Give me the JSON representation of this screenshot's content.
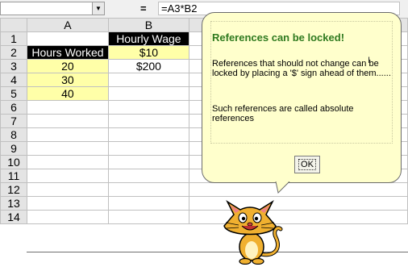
{
  "formula_bar": {
    "name_box": "",
    "equals": "=",
    "formula": "=A3*B2"
  },
  "grid": {
    "columns": [
      "A",
      "B"
    ],
    "rows": [
      {
        "num": "1",
        "a": "",
        "b": "Hourly Wage"
      },
      {
        "num": "2",
        "a": "Hours Worked",
        "b": "$10"
      },
      {
        "num": "3",
        "a": "20",
        "b": "$200"
      },
      {
        "num": "4",
        "a": "30",
        "b": ""
      },
      {
        "num": "5",
        "a": "40",
        "b": ""
      },
      {
        "num": "6",
        "a": "",
        "b": ""
      },
      {
        "num": "7",
        "a": "",
        "b": ""
      },
      {
        "num": "8",
        "a": "",
        "b": ""
      },
      {
        "num": "9",
        "a": "",
        "b": ""
      },
      {
        "num": "10",
        "a": "",
        "b": ""
      },
      {
        "num": "11",
        "a": "",
        "b": ""
      },
      {
        "num": "12",
        "a": "",
        "b": ""
      },
      {
        "num": "13",
        "a": "",
        "b": ""
      },
      {
        "num": "14",
        "a": "",
        "b": ""
      }
    ]
  },
  "balloon": {
    "title": "References can be locked!",
    "paragraph1": "References that should not change can be locked by placing a '$' sign ahead of them......",
    "paragraph2": "Such references are called absolute references",
    "ok_label": "OK"
  },
  "colors": {
    "title": "#2f7a1f",
    "balloon_bg": "#ffffcc",
    "cell_yellow": "#ffffa8",
    "header_black": "#000000"
  },
  "icons": {
    "assistant": "office-assistant-cat-icon"
  }
}
